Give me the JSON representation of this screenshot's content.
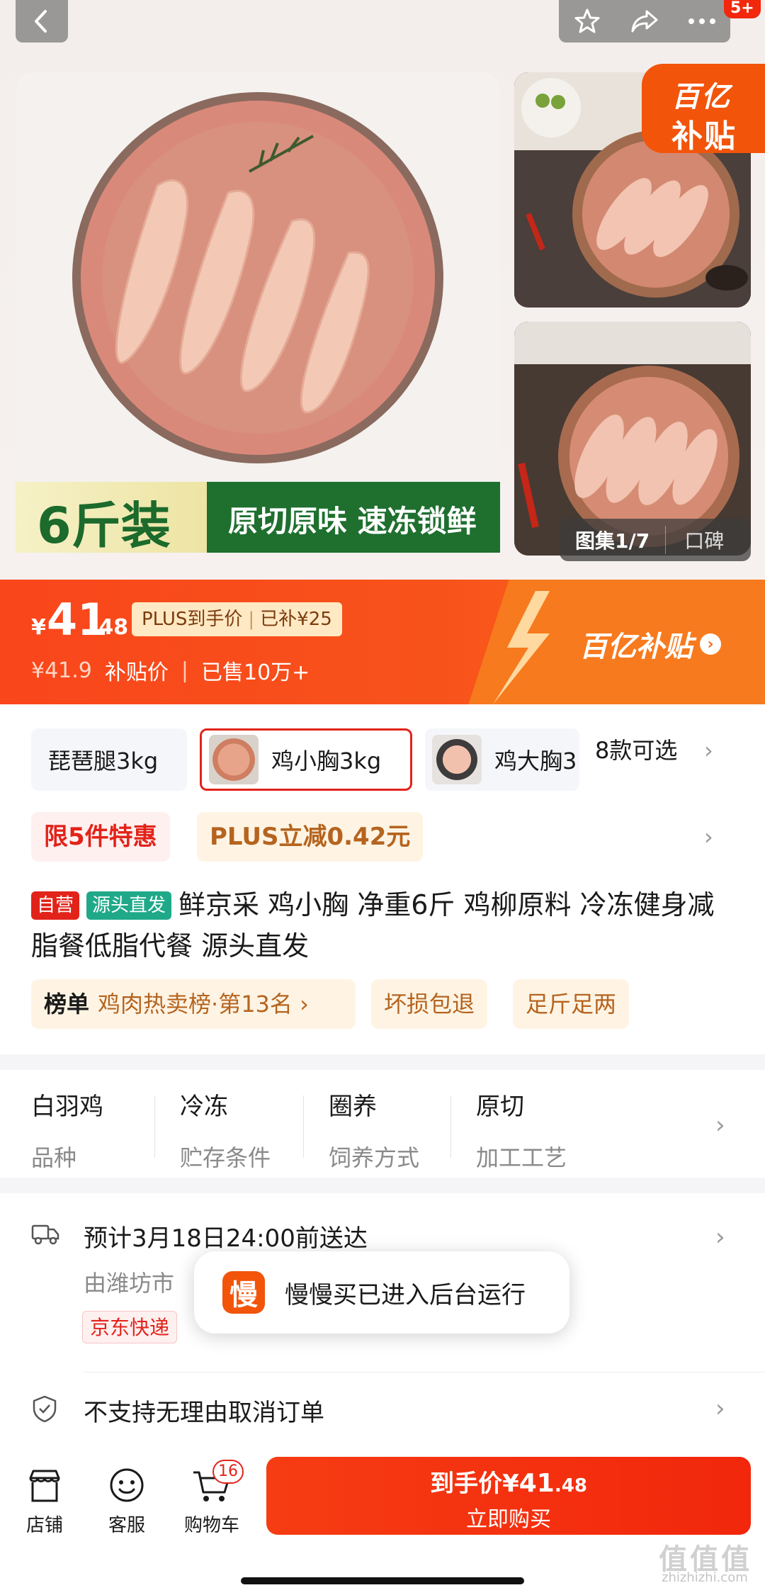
{
  "top": {
    "cart_count": "5+"
  },
  "gallery": {
    "banner_weight": "6斤装",
    "banner_slogan": "原切原味  速冻锁鲜",
    "subsidy_badge_line1": "百亿",
    "subsidy_badge_line2": "补贴",
    "album_label": "图集1/7",
    "review_label": "口碑"
  },
  "price": {
    "currency": "¥",
    "integer": "41",
    "decimal": ".48",
    "plus_label": "PLUS到手价",
    "subsidy_label": "已补¥25",
    "original": "¥41.9",
    "subsidy_price_label": "补贴价",
    "sold": "已售10万+",
    "brand_label": "百亿补贴"
  },
  "variants": {
    "items": [
      {
        "label": "琵琶腿3kg"
      },
      {
        "label": "鸡小胸3kg"
      },
      {
        "label": "鸡大胸3"
      }
    ],
    "more_label": "8款可选"
  },
  "promos": [
    "限5件特惠",
    "PLUS立减0.42元"
  ],
  "product": {
    "tag_self": "自营",
    "tag_origin": "源头直发",
    "title": "鲜京采 鸡小胸 净重6斤 鸡柳原料 冷冻健身减脂餐低脂代餐 源头直发"
  },
  "chips": {
    "rank_prefix": "榜单",
    "rank_text": "鸡肉热卖榜·第13名 ›",
    "chip2": "坏损包退",
    "chip3": "足斤足两"
  },
  "attributes": [
    {
      "value": "白羽鸡",
      "key": "品种"
    },
    {
      "value": "冷冻",
      "key": "贮存条件"
    },
    {
      "value": "圈养",
      "key": "饲养方式"
    },
    {
      "value": "原切",
      "key": "加工工艺"
    }
  ],
  "delivery": {
    "eta": "预计3月18日24:00前送达",
    "from": "由潍坊市",
    "carrier": "京东快递"
  },
  "policy": "不支持无理由取消订单",
  "toast": {
    "app_icon_char": "慢",
    "message": "慢慢买已进入后台运行"
  },
  "bottom": {
    "store": "店铺",
    "service": "客服",
    "cart": "购物车",
    "cart_badge": "16",
    "buy_prefix": "到手价¥",
    "buy_int": "41",
    "buy_dec": ".48",
    "buy_label": "立即购买"
  },
  "watermark": {
    "line1": "值值值",
    "line2": "zhizhizhi.com"
  },
  "colors": {
    "accent": "#f2270c",
    "subsidy_orange": "#f2540a",
    "green_tag": "#1fa989"
  }
}
